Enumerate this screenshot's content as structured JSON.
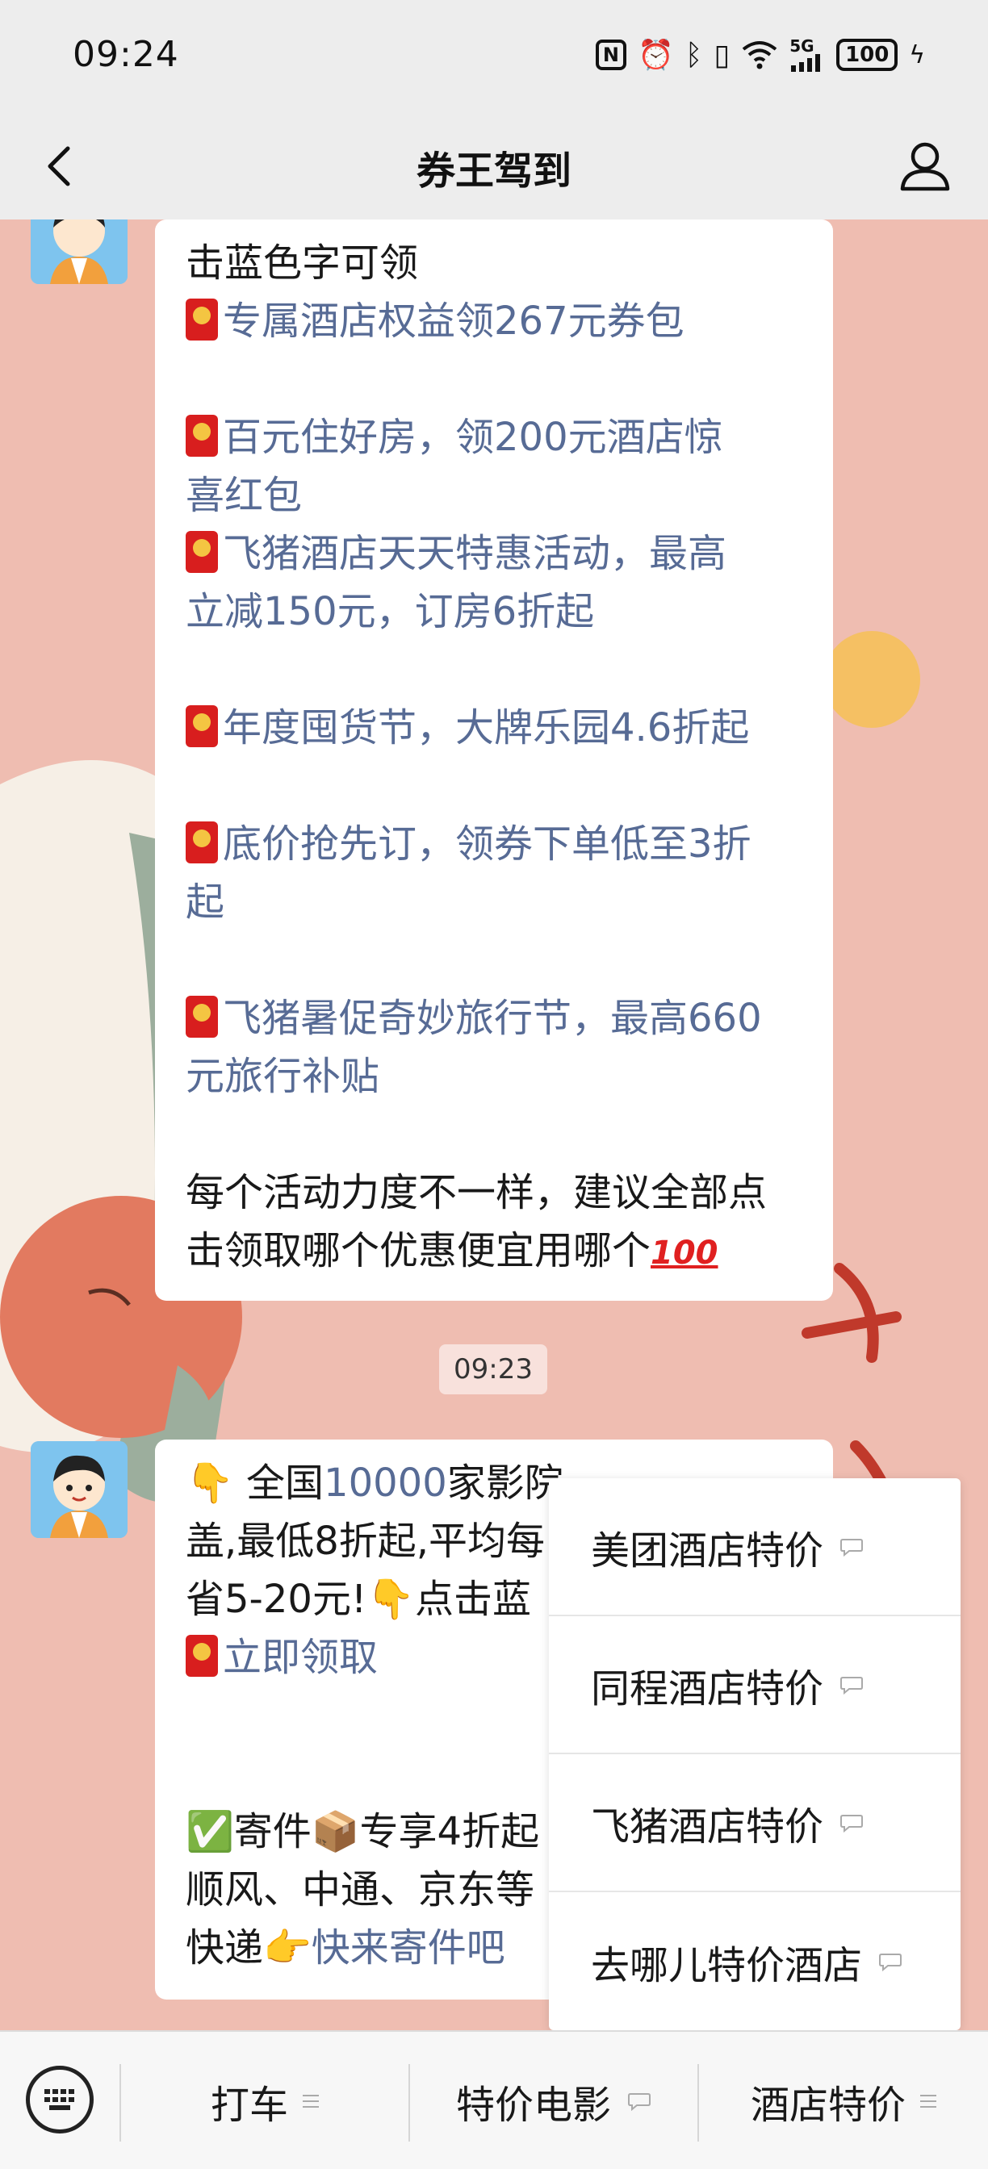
{
  "status": {
    "time": "09:24",
    "network": "5G",
    "battery": "100"
  },
  "nav": {
    "title": "券王驾到"
  },
  "message1": {
    "lines": [
      {
        "parts": [
          {
            "t": "击蓝色字可领",
            "link": false
          }
        ]
      },
      {
        "env": true,
        "parts": [
          {
            "t": "专属酒店权益领267元券包",
            "link": true
          }
        ]
      },
      {
        "gap": true
      },
      {
        "env": true,
        "parts": [
          {
            "t": "百元住好房，领200元酒店惊",
            "link": true
          }
        ]
      },
      {
        "parts": [
          {
            "t": "喜红包",
            "link": true
          }
        ]
      },
      {
        "env": true,
        "parts": [
          {
            "t": "飞猪酒店天天特惠活动，最高",
            "link": true
          }
        ]
      },
      {
        "parts": [
          {
            "t": "立减150元，订房6折起",
            "link": true
          }
        ]
      },
      {
        "gap": true
      },
      {
        "env": true,
        "parts": [
          {
            "t": "年度囤货节，大牌乐园4.6折起",
            "link": true
          }
        ]
      },
      {
        "gap": true
      },
      {
        "env": true,
        "parts": [
          {
            "t": "底价抢先订，领券下单低至3折",
            "link": true
          }
        ]
      },
      {
        "parts": [
          {
            "t": "起",
            "link": true
          }
        ]
      },
      {
        "gap": true
      },
      {
        "env": true,
        "parts": [
          {
            "t": "飞猪暑促奇妙旅行节，最高660",
            "link": true
          }
        ]
      },
      {
        "parts": [
          {
            "t": "元旅行补贴",
            "link": true
          }
        ]
      },
      {
        "gap": true
      },
      {
        "parts": [
          {
            "t": "每个活动力度不一样，建议全部点",
            "link": false
          }
        ]
      },
      {
        "parts": [
          {
            "t": "击领取哪个优惠便宜用哪个",
            "link": false
          }
        ],
        "hundred": "100"
      }
    ]
  },
  "timestamp": "09:23",
  "message2": {
    "lines": [
      {
        "parts": [
          {
            "t": "👇 全国",
            "link": false
          },
          {
            "t": "10000",
            "link": true
          },
          {
            "t": "家影院",
            "link": false
          }
        ]
      },
      {
        "parts": [
          {
            "t": "盖,最低8折起,平均每",
            "link": false
          }
        ]
      },
      {
        "parts": [
          {
            "t": "省5-20元!👇点击蓝",
            "link": false
          }
        ]
      },
      {
        "env": true,
        "parts": [
          {
            "t": "立即领取",
            "link": true
          }
        ]
      },
      {
        "gap": true
      },
      {
        "gap": true
      },
      {
        "parts": [
          {
            "t": "✅寄件📦专享4折起",
            "link": false
          }
        ]
      },
      {
        "parts": [
          {
            "t": "顺风、中通、京东等",
            "link": false
          }
        ]
      },
      {
        "parts": [
          {
            "t": "快递👉",
            "link": false
          },
          {
            "t": "快来寄件吧",
            "link": true
          }
        ]
      }
    ]
  },
  "popup": {
    "items": [
      {
        "label": "美团酒店特价"
      },
      {
        "label": "同程酒店特价"
      },
      {
        "label": "飞猪酒店特价"
      },
      {
        "label": "去哪儿特价酒店"
      }
    ]
  },
  "bottom": {
    "tabs": [
      {
        "label": "打车",
        "icon": "menu-lines-icon"
      },
      {
        "label": "特价电影",
        "icon": "chat-bubble-icon"
      },
      {
        "label": "酒店特价",
        "icon": "menu-lines-icon"
      }
    ]
  },
  "colors": {
    "link": "#576b95",
    "chat_bg": "#efbdb1",
    "envelope": "#d81e1e"
  }
}
